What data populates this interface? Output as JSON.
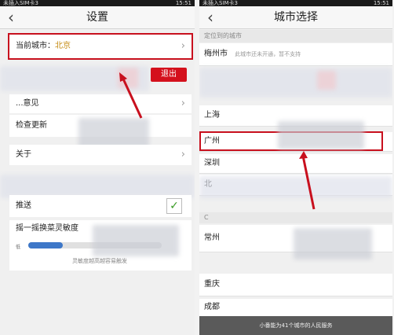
{
  "left": {
    "status_left": "未插入SIM卡3",
    "status_time": "15:51",
    "title": "设置",
    "current_city_label": "当前城市：",
    "current_city_value": "北京",
    "logout_label": "退出",
    "feedback_label": "...意见",
    "check_update_label": "检查更新",
    "about_label": "关于",
    "push_label": "推送",
    "push_checked": "✓",
    "shake_label": "摇一摇换菜灵敏度",
    "low_label": "低",
    "sensitivity_level": 0.26,
    "hint": "灵敏度越高越容易触发"
  },
  "right": {
    "status_left": "未插入SIM卡3",
    "status_time": "15:51",
    "title": "城市选择",
    "located_section": "定位到的城市",
    "located_city": "梅州市",
    "located_note": "此城市还未开通，暂不支持",
    "cities": [
      "上海",
      "广州",
      "深圳",
      "北"
    ],
    "section_c": "C",
    "cities_c": [
      "常州",
      "重庆",
      "成都"
    ],
    "bottom_text": "小番能为41个城市的人民服务"
  },
  "colors": {
    "accent": "#c8101e",
    "slider": "#3d77c8",
    "check": "#3a9b25"
  }
}
